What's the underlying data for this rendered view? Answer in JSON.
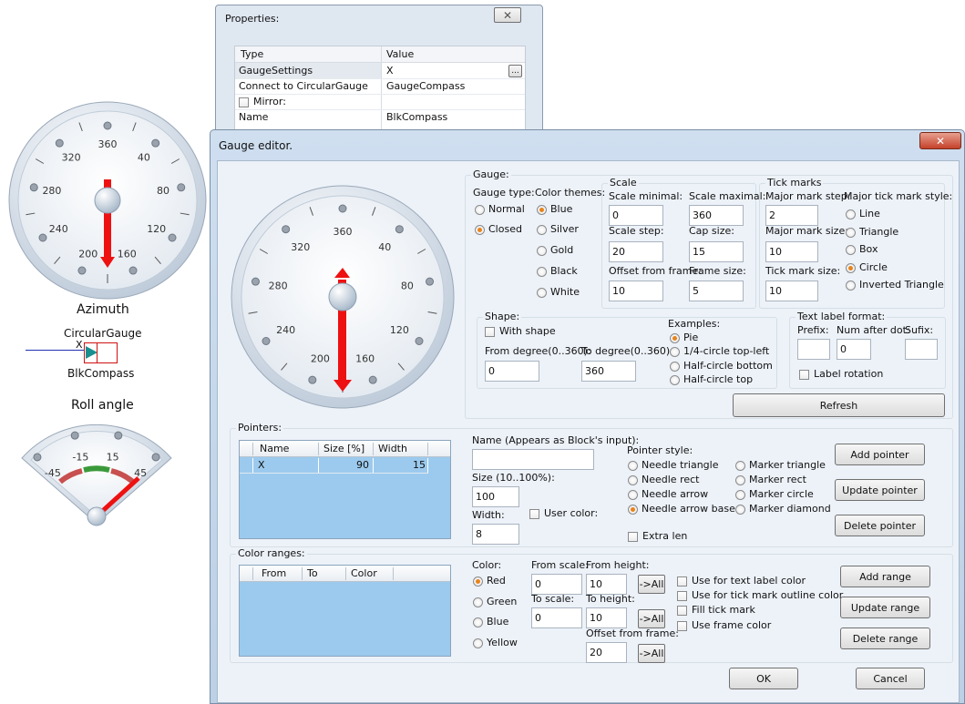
{
  "left_panel": {
    "azimuth_label": "Azimuth",
    "block_type": "CircularGauge",
    "block_input": "X",
    "block_name": "BlkCompass",
    "roll_label": "Roll angle",
    "azimuth_ticks": [
      "360",
      "40",
      "80",
      "120",
      "160",
      "200",
      "240",
      "280",
      "320"
    ],
    "roll_ticks": [
      "-45",
      "-15",
      "15",
      "45"
    ]
  },
  "properties": {
    "title": "Properties:",
    "col_type": "Type",
    "col_value": "Value",
    "ellipsis": "...",
    "rows": [
      {
        "name": "GaugeSettings",
        "value": "X"
      },
      {
        "name": "Connect to CircularGauge",
        "value": "GaugeCompass"
      },
      {
        "name": "Mirror:",
        "value": ""
      },
      {
        "name": "Name",
        "value": "BlkCompass"
      }
    ]
  },
  "dialog": {
    "title": "Gauge editor.",
    "gauge": {
      "group_title": "Gauge:",
      "type_label": "Gauge type:",
      "types": [
        "Normal",
        "Closed"
      ],
      "selected_type": "Closed",
      "themes_label": "Color themes:",
      "themes": [
        "Blue",
        "Silver",
        "Gold",
        "Black",
        "White"
      ],
      "selected_theme": "Blue",
      "scale": {
        "title": "Scale",
        "min_label": "Scale minimal:",
        "min": "0",
        "max_label": "Scale maximal:",
        "max": "360",
        "step_label": "Scale step:",
        "step": "20",
        "cap_label": "Cap size:",
        "cap": "15",
        "offset_label": "Offset from frame:",
        "offset": "10",
        "frame_label": "Frame size:",
        "frame": "5"
      },
      "ticks": {
        "title": "Tick marks",
        "major_step_label": "Major mark step:",
        "major_step": "2",
        "major_size_label": "Major mark size:",
        "major_size": "10",
        "tick_size_label": "Tick mark size:",
        "tick_size": "10",
        "style_label": "Major tick mark style:",
        "styles": [
          "Line",
          "Triangle",
          "Box",
          "Circle",
          "Inverted Triangle"
        ],
        "selected_style": "Circle"
      },
      "shape": {
        "title": "Shape:",
        "with_shape": "With shape",
        "from_label": "From degree(0..360):",
        "from": "0",
        "to_label": "To degree(0..360):",
        "to": "360",
        "examples_label": "Examples:",
        "examples": [
          "Pie",
          "1/4-circle top-left",
          "Half-circle bottom",
          "Half-circle top"
        ],
        "selected_example": "Pie"
      },
      "text_format": {
        "title": "Text label format:",
        "prefix_label": "Prefix:",
        "prefix": "",
        "num_label": "Num after dot:",
        "num": "0",
        "sufix_label": "Sufix:",
        "sufix": "",
        "rotation": "Label rotation"
      },
      "refresh": "Refresh",
      "preview_ticks": [
        "360",
        "40",
        "80",
        "120",
        "160",
        "200",
        "240",
        "280",
        "320"
      ]
    },
    "pointers": {
      "title": "Pointers:",
      "columns": [
        "Name",
        "Size [%]",
        "Width"
      ],
      "rows": [
        {
          "name": "X",
          "size": "90",
          "width": "15"
        }
      ],
      "name_label": "Name (Appears as Block's input):",
      "name_value": "",
      "size_label": "Size (10..100%):",
      "size": "100",
      "width_label": "Width:",
      "width": "8",
      "user_color": "User color:",
      "style_label": "Pointer style:",
      "styles": [
        "Needle triangle",
        "Needle rect",
        "Needle arrow",
        "Needle arrow base",
        "Marker triangle",
        "Marker rect",
        "Marker circle",
        "Marker diamond"
      ],
      "selected_style": "Needle arrow base",
      "extra_len": "Extra len",
      "add": "Add pointer",
      "update": "Update pointer",
      "delete": "Delete pointer"
    },
    "ranges": {
      "title": "Color ranges:",
      "columns": [
        "From",
        "To",
        "Color"
      ],
      "color_label": "Color:",
      "colors": [
        "Red",
        "Green",
        "Blue",
        "Yellow"
      ],
      "selected_color": "Red",
      "from_scale_label": "From scale:",
      "from_scale": "0",
      "to_scale_label": "To scale:",
      "to_scale": "0",
      "from_height_label": "From height:",
      "from_height": "10",
      "to_height_label": "To height:",
      "to_height": "10",
      "offset_label": "Offset from frame:",
      "offset": "20",
      "all": "->All",
      "options": [
        "Use for text label color",
        "Use for tick mark outline color",
        "Fill tick mark",
        "Use frame color"
      ],
      "add": "Add range",
      "update": "Update range",
      "delete": "Delete range"
    },
    "ok": "OK",
    "cancel": "Cancel"
  },
  "colors": {
    "dialog_bg": "#edf2f9",
    "needle": "#ee1111",
    "list_bg": "#9ccaee",
    "radio_accent": "#e8831a"
  }
}
